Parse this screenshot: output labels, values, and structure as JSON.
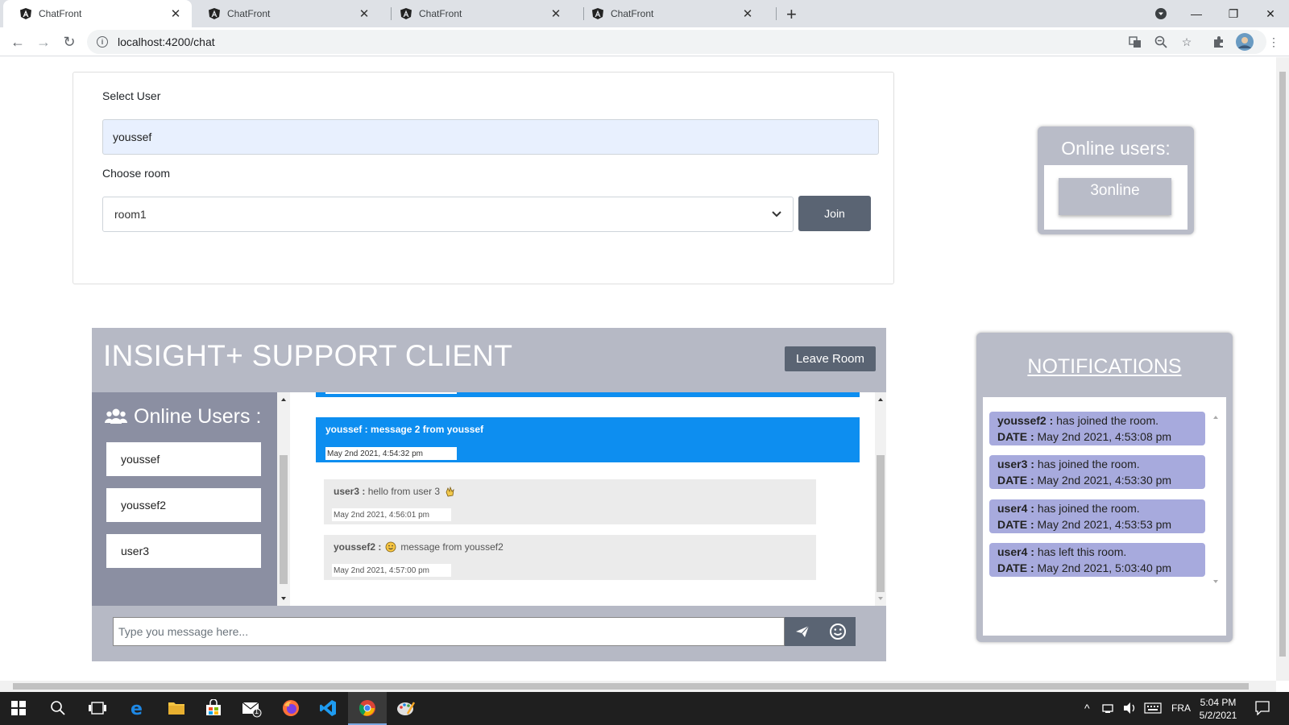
{
  "browser": {
    "tabs": [
      "ChatFront",
      "ChatFront",
      "ChatFront",
      "ChatFront"
    ],
    "url": "localhost:4200/chat"
  },
  "form": {
    "select_user_label": "Select User",
    "user_value": "youssef",
    "choose_room_label": "Choose room",
    "room_value": "room1",
    "join_label": "Join"
  },
  "online_widget": {
    "title": "Online users:",
    "count": "3online"
  },
  "chat": {
    "title": "INSIGHT+ SUPPORT CLIENT",
    "leave_label": "Leave Room",
    "online_users_title": "Online Users :",
    "users": [
      "youssef",
      "youssef2",
      "user3"
    ],
    "messages": [
      {
        "author": "youssef :",
        "text": "message 2 from youssef",
        "date": "May 2nd 2021, 4:54:32 pm"
      },
      {
        "author": "user3 :",
        "text": "hello from user 3",
        "date": "May 2nd 2021, 4:56:01 pm"
      },
      {
        "author": "youssef2 :",
        "text": "message from youssef2",
        "date": "May 2nd 2021, 4:57:00 pm"
      }
    ],
    "input_placeholder": "Type you message here..."
  },
  "notifications": {
    "title": "NOTIFICATIONS",
    "date_label": "DATE :",
    "items": [
      {
        "user": "youssef2 :",
        "event": "has joined the room.",
        "date": "May 2nd 2021, 4:53:08 pm"
      },
      {
        "user": "user3 :",
        "event": "has joined the room.",
        "date": "May 2nd 2021, 4:53:30 pm"
      },
      {
        "user": "user4 :",
        "event": "has joined the room.",
        "date": "May 2nd 2021, 4:53:53 pm"
      },
      {
        "user": "user4 :",
        "event": "has left this room.",
        "date": "May 2nd 2021, 5:03:40 pm"
      }
    ]
  },
  "taskbar": {
    "time": "5:04 PM",
    "date": "5/2/2021",
    "lang": "FRA",
    "mail_badge": "1"
  },
  "colors": {
    "accent_blue": "#0d8ef0",
    "panel_gray": "#b6b9c5",
    "button_dark": "#5a6473",
    "notif_item": "#a7aadd"
  }
}
